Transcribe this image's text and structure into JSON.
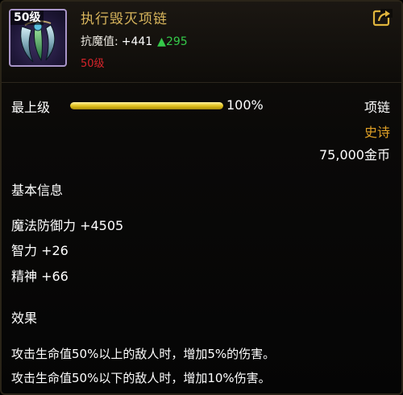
{
  "item": {
    "level_badge": "50级",
    "name": "执行毁灭项链",
    "resist_label": "抗魔值:",
    "resist_value": "+441",
    "resist_up": "▲295",
    "required_level": "50级"
  },
  "quality": {
    "label": "最上级",
    "percent_text": "100%",
    "fill_fraction": 1.0
  },
  "meta": {
    "type": "项链",
    "rarity": "史诗",
    "price": "75,000金币"
  },
  "basic_info": {
    "title": "基本信息",
    "stats": [
      "魔法防御力 +4505",
      "智力 +26",
      "精神 +66"
    ]
  },
  "effects": {
    "title": "效果",
    "lines": [
      "攻击生命值50%以上的敌人时，增加5%的伤害。",
      "攻击生命值50%以下的敌人时，增加10%伤害。"
    ]
  },
  "icons": {
    "item_icon": "claw-necklace-icon",
    "share_icon": "share-export-icon"
  },
  "colors": {
    "name": "#d8b55c",
    "rarity": "#e0a126",
    "required_level": "#d6242a",
    "stat_up": "#35c94a",
    "bar_fill": "#e2c21f"
  }
}
